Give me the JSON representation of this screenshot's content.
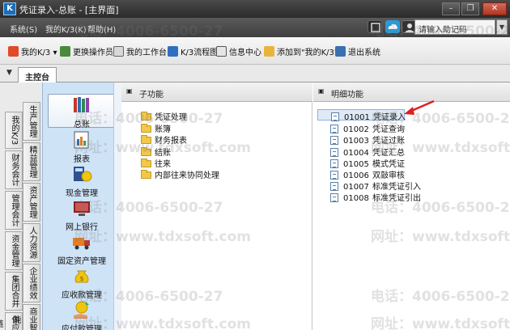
{
  "window": {
    "title": "凭证录入-总账 - [主界面]",
    "app_icon": "K",
    "minimize_glyph": "–",
    "restore_glyph": "❐",
    "close_glyph": "✕"
  },
  "menubar": {
    "items": [
      "系统(S)",
      "我的K/3(K)",
      "帮助(H)"
    ],
    "search_placeholder": "请输入助记码",
    "search_arrow": "▼"
  },
  "toolbar": {
    "items": [
      "我的K/3",
      "更换操作员",
      "我的工作台",
      "K/3流程图",
      "信息中心",
      "添加到\"我的K/3\"",
      "退出系统"
    ],
    "dropdown_glyph": "▾"
  },
  "tabs": {
    "dropdown_glyph": "▼",
    "main_tab": "主控台"
  },
  "left_tabs": [
    "我的K/3",
    "财务会计",
    "管理会计",
    "资金管理",
    "集团合并",
    "供应链",
    "生产管理",
    "精益管理",
    "资产管理",
    "人力资源",
    "企业绩效",
    "商业智能"
  ],
  "modules": [
    {
      "label": "总账",
      "icon": "ledger-books-icon"
    },
    {
      "label": "报表",
      "icon": "report-icon"
    },
    {
      "label": "现金管理",
      "icon": "cash-calculator-icon"
    },
    {
      "label": "网上银行",
      "icon": "online-bank-icon"
    },
    {
      "label": "固定资产管理",
      "icon": "truck-icon"
    },
    {
      "label": "应收款管理",
      "icon": "money-bag-icon"
    },
    {
      "label": "应付款管理",
      "icon": "money-hand-icon"
    }
  ],
  "subfunctions": {
    "header": "子功能",
    "expand_glyph": "▣",
    "items": [
      "凭证处理",
      "账簿",
      "财务报表",
      "结账",
      "往来",
      "内部往来协同处理"
    ]
  },
  "details": {
    "header": "明细功能",
    "expand_glyph": "▣",
    "items": [
      {
        "code": "01001",
        "name": "凭证录入"
      },
      {
        "code": "01002",
        "name": "凭证查询"
      },
      {
        "code": "01003",
        "name": "凭证过账"
      },
      {
        "code": "01004",
        "name": "凭证汇总"
      },
      {
        "code": "01005",
        "name": "模式凭证"
      },
      {
        "code": "01006",
        "name": "双敲审核"
      },
      {
        "code": "01007",
        "name": "标准凭证引入"
      },
      {
        "code": "01008",
        "name": "标准凭证引出"
      }
    ]
  },
  "watermarks": {
    "phone": "电话：4006-6500-27",
    "site": "网址：www.tdxsoft.com"
  },
  "colors": {
    "selection_bg": "#dfeaf6",
    "module_panel_bg": "#cfe3f7",
    "folder": "#f2c84b",
    "arrow": "#e02020"
  }
}
